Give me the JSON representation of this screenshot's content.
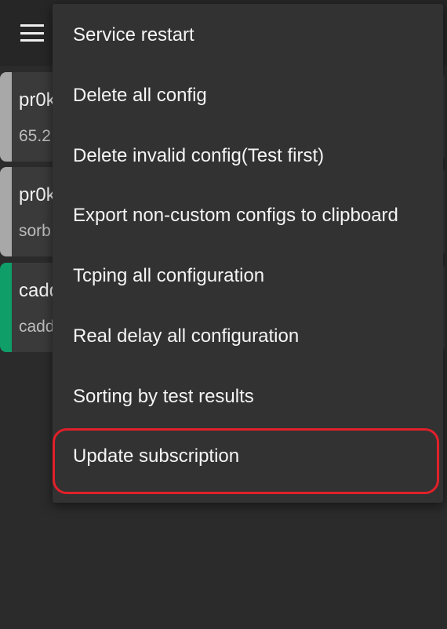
{
  "toolbar": {
    "menu_icon": "hamburger-icon"
  },
  "servers": [
    {
      "name": "pr0k",
      "address": "65.2",
      "status_color": "#a8a8a8"
    },
    {
      "name": "pr0k",
      "address": "sorb",
      "status_color": "#a8a8a8"
    },
    {
      "name": "cadd",
      "address": "cadd",
      "status_color": "#0f9d68"
    }
  ],
  "menu": {
    "items": [
      {
        "label": "Service restart"
      },
      {
        "label": "Delete all config"
      },
      {
        "label": "Delete invalid config(Test first)"
      },
      {
        "label": "Export non-custom configs to clipboard"
      },
      {
        "label": "Tcping all configuration"
      },
      {
        "label": "Real delay all configuration"
      },
      {
        "label": "Sorting by test results"
      },
      {
        "label": "Update subscription"
      }
    ]
  },
  "highlight_color": "#e0202a"
}
